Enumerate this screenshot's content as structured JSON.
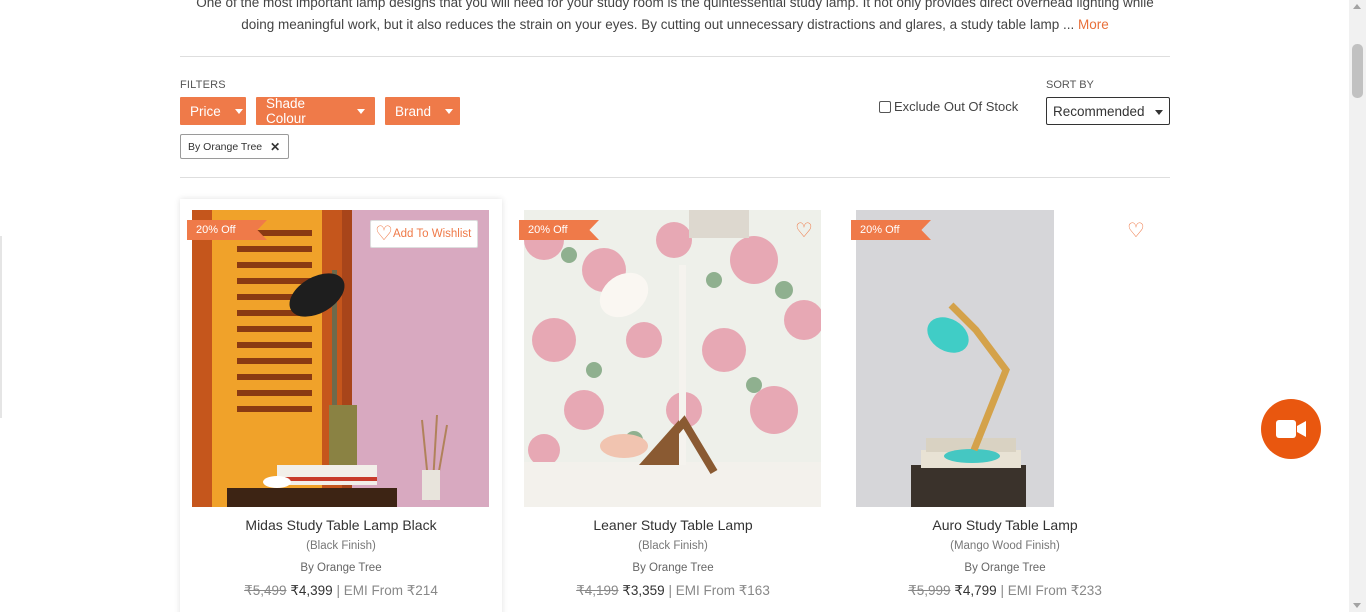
{
  "intro": {
    "line1": "One of the most important lamp designs that you will need for your study room is the quintessential study lamp. It not only provides direct overhead lighting while",
    "line2": "doing meaningful work, but it also reduces the strain on your eyes. By cutting out unnecessary distractions and glares, a study table lamp ...",
    "more": "More"
  },
  "filters": {
    "label": "FILTERS",
    "buttons": [
      "Price",
      "Shade Colour",
      "Brand"
    ],
    "active_chip": "By Orange Tree",
    "exclude_label": "Exclude Out Of Stock"
  },
  "sort": {
    "label": "SORT BY",
    "value": "Recommended"
  },
  "products": [
    {
      "badge": "20% Off",
      "wishlist": "Add To Wishlist",
      "title": "Midas Study Table Lamp Black",
      "finish": "(Black Finish)",
      "brand": "By Orange Tree",
      "old_price": "₹5,499",
      "price": "₹4,399",
      "emi": "| EMI From ₹214"
    },
    {
      "badge": "20% Off",
      "title": "Leaner Study Table Lamp",
      "finish": "(Black Finish)",
      "brand": "By Orange Tree",
      "old_price": "₹4,199",
      "price": "₹3,359",
      "emi": "| EMI From ₹163"
    },
    {
      "badge": "20% Off",
      "title": "Auro Study Table Lamp",
      "finish": "(Mango Wood Finish)",
      "brand": "By Orange Tree",
      "old_price": "₹5,999",
      "price": "₹4,799",
      "emi": "| EMI From ₹233"
    }
  ],
  "colors": {
    "accent": "#ef7a49",
    "fab": "#e9570f"
  },
  "icons": {
    "heart": "heart-icon",
    "close": "close-icon",
    "video": "video-camera-icon"
  }
}
